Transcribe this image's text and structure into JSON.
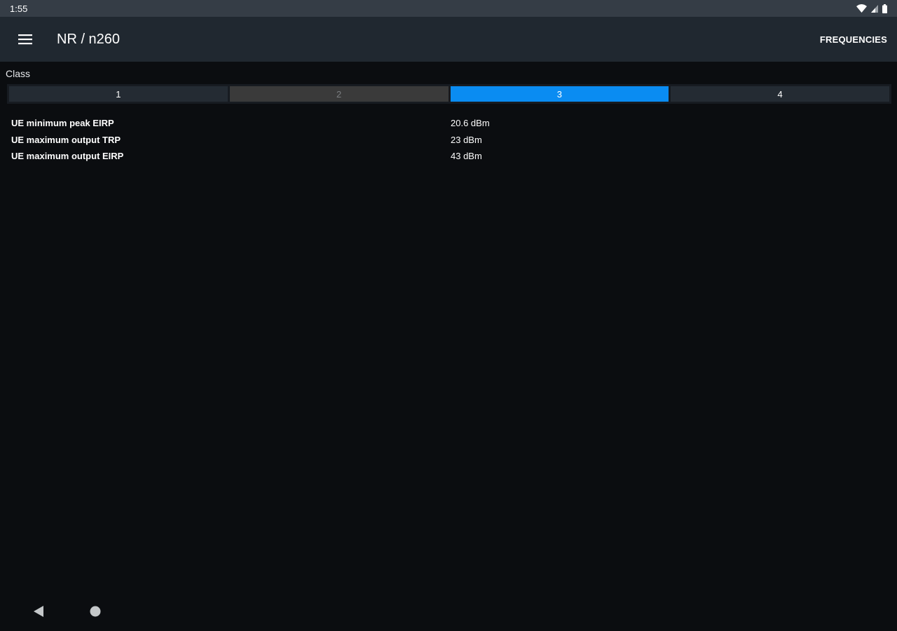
{
  "status_bar": {
    "time": "1:55",
    "icons": [
      "wifi-icon",
      "cell-signal-icon",
      "battery-icon"
    ]
  },
  "app_bar": {
    "title": "NR / n260",
    "action_label": "FREQUENCIES",
    "menu_icon": "menu-icon"
  },
  "class_selector": {
    "label": "Class",
    "options": [
      {
        "label": "1",
        "state": "normal"
      },
      {
        "label": "2",
        "state": "disabled"
      },
      {
        "label": "3",
        "state": "selected"
      },
      {
        "label": "4",
        "state": "normal"
      }
    ]
  },
  "properties": [
    {
      "name": "UE minimum peak EIRP",
      "value": "20.6 dBm"
    },
    {
      "name": "UE maximum output TRP",
      "value": "23 dBm"
    },
    {
      "name": "UE maximum output EIRP",
      "value": "43 dBm"
    }
  ],
  "nav_bar": {
    "icons": [
      "back-icon",
      "home-icon"
    ]
  },
  "colors": {
    "accent": "#0a8cf2",
    "app_bar": "#202830",
    "status_bar": "#353d46",
    "background": "#0b0d10"
  }
}
